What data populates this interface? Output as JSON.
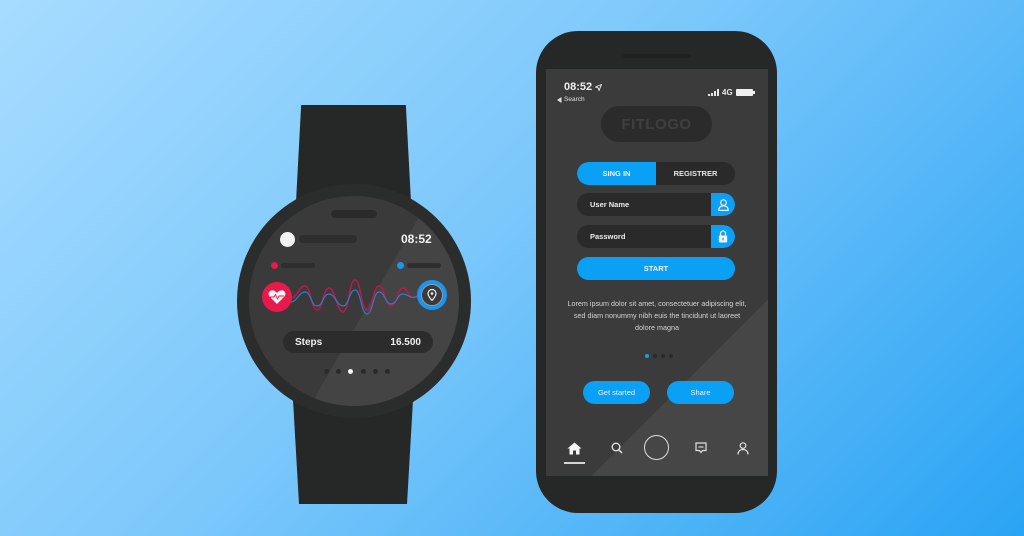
{
  "colors": {
    "accent_blue": "#0aa0f5",
    "heart_red": "#e8194c",
    "device_dark": "#262828",
    "screen_dark": "#3b3b3b"
  },
  "watch": {
    "time": "08:52",
    "steps_label": "Steps",
    "steps_value": "16.500",
    "heart_icon": "heart-pulse-icon",
    "location_icon": "location-pin-icon",
    "page_dots": {
      "count": 6,
      "active_index": 2
    }
  },
  "phone": {
    "status_bar": {
      "time": "08:52",
      "location_icon": "location-arrow-icon",
      "back_label": "Search",
      "network": "4G"
    },
    "logo": "FITLOGO",
    "tabs": [
      {
        "label": "SING IN",
        "active": true
      },
      {
        "label": "REGISTRER",
        "active": false
      }
    ],
    "fields": {
      "username": {
        "placeholder": "User Name",
        "value": "",
        "icon": "user-icon"
      },
      "password": {
        "placeholder": "Password",
        "value": "",
        "icon": "lock-icon"
      }
    },
    "start_label": "START",
    "description": "Lorem ipsum dolor sit amet, consectetuer adipiscing elit, sed diam nonummy nibh euis the tincidunt ut laoreet dolore magna",
    "page_dots": {
      "count": 4,
      "active_index": 0
    },
    "buttons": {
      "get_started": "Get started",
      "share": "Share"
    },
    "nav": [
      {
        "name": "home",
        "icon": "home-icon",
        "active": true
      },
      {
        "name": "search",
        "icon": "search-icon",
        "active": false
      },
      {
        "name": "center",
        "icon": "circle-button-icon",
        "active": false
      },
      {
        "name": "messages",
        "icon": "chat-icon",
        "active": false
      },
      {
        "name": "profile",
        "icon": "profile-icon",
        "active": false
      }
    ]
  }
}
